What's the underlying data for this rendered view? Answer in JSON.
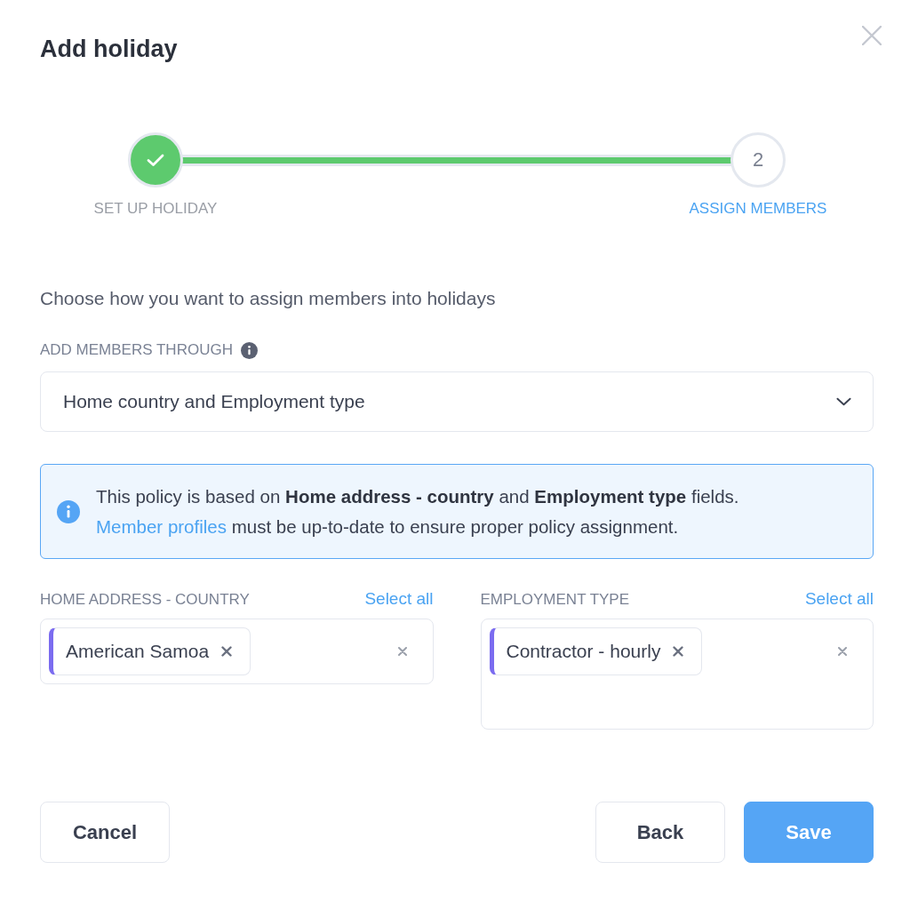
{
  "dialog": {
    "title": "Add holiday"
  },
  "stepper": {
    "steps": [
      {
        "label": "SET UP HOLIDAY",
        "completed": true,
        "selected": false
      },
      {
        "label": "ASSIGN MEMBERS",
        "number": "2",
        "completed": false,
        "selected": true
      }
    ]
  },
  "prompt": "Choose how you want to assign members into holidays",
  "method_field": {
    "label": "ADD MEMBERS THROUGH",
    "value": "Home country and Employment type"
  },
  "notice": {
    "text": "This policy is based on **Home address - country** and **Employment type** fields.",
    "link": "Member profiles",
    "text_after": "must be up-to-date to ensure proper policy assignment."
  },
  "filters": [
    {
      "label": "HOME ADDRESS - COUNTRY",
      "select_all": "Select all",
      "chips": [
        "American Samoa"
      ]
    },
    {
      "label": "EMPLOYMENT TYPE",
      "select_all": "Select all",
      "chips": [
        "Contractor - hourly"
      ]
    }
  ],
  "actions": [
    {
      "label": "Cancel",
      "kind": "secondary"
    },
    {
      "label": "Back",
      "kind": "secondary"
    },
    {
      "label": "Save",
      "kind": "primary"
    }
  ]
}
